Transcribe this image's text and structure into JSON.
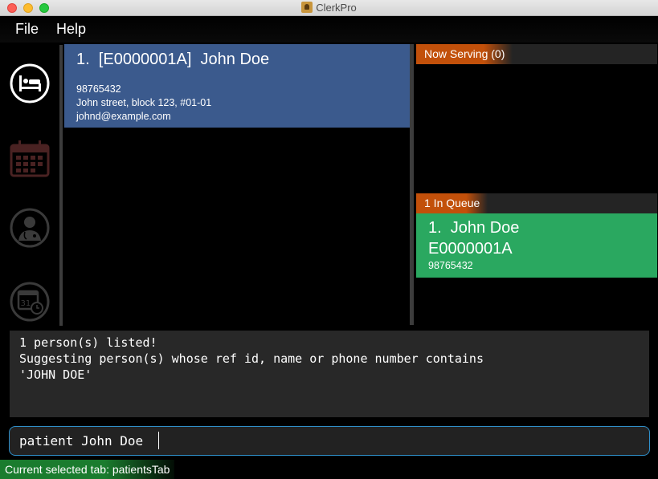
{
  "window": {
    "title": "ClerkPro"
  },
  "menu": {
    "file": "File",
    "help": "Help"
  },
  "sidebar": {
    "tabs": [
      {
        "name": "patients",
        "icon": "patient-bed-icon",
        "selected": true
      },
      {
        "name": "appointments",
        "icon": "calendar-icon",
        "selected": false
      },
      {
        "name": "doctors",
        "icon": "doctor-icon",
        "selected": false
      },
      {
        "name": "schedule",
        "icon": "calendar-clock-icon",
        "selected": false
      }
    ]
  },
  "person_list": {
    "items": [
      {
        "title": "1.  [E0000001A]  John Doe",
        "phone": "98765432",
        "address": "John street, block 123, #01-01",
        "email": "johnd@example.com"
      }
    ]
  },
  "serving": {
    "header": "Now Serving (0)"
  },
  "queue": {
    "header": "1 In Queue",
    "items": [
      {
        "name": "1.  John Doe",
        "ref_id": "E0000001A",
        "phone": "98765432"
      }
    ]
  },
  "result": {
    "lines": [
      "1 person(s) listed!",
      "Suggesting person(s) whose ref id, name or phone number contains",
      "'JOHN DOE'"
    ]
  },
  "command": {
    "value": "patient John Doe"
  },
  "status": {
    "text": "Current selected tab: patientsTab"
  },
  "colors": {
    "person_card": "#3b5a8d",
    "queue_card": "#2aa860",
    "header_accent": "#c2500a",
    "status_accent": "#1a7c2e",
    "command_border": "#2f8fc9"
  }
}
